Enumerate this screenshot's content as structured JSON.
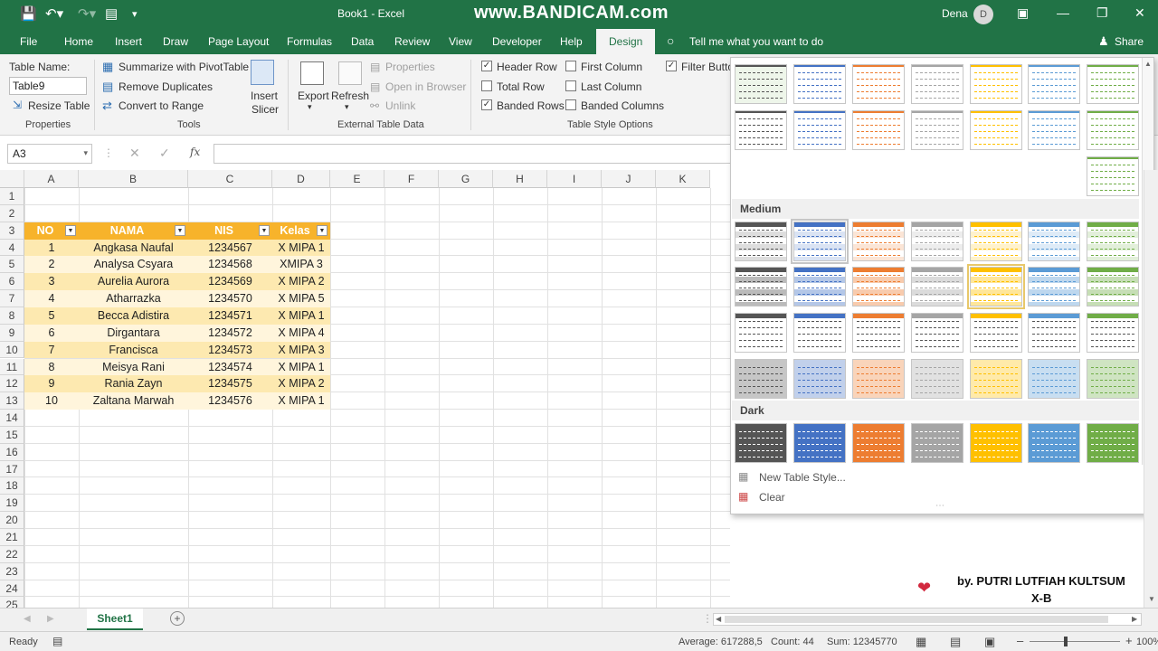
{
  "titlebar": {
    "title": "Book1  -  Excel",
    "watermark": "www.BANDICAM.com",
    "user_name": "Dena",
    "avatar_letter": "D",
    "accent_color": "#217346"
  },
  "tabs": [
    "File",
    "Home",
    "Insert",
    "Draw",
    "Page Layout",
    "Formulas",
    "Data",
    "Review",
    "View",
    "Developer",
    "Help",
    "Design"
  ],
  "active_tab": "Design",
  "tellme": "Tell me what you want to do",
  "share": "Share",
  "ribbon": {
    "properties": {
      "table_name_label": "Table Name:",
      "table_name_value": "Table9",
      "resize": "Resize Table",
      "group": "Properties"
    },
    "tools": {
      "pivot": "Summarize with PivotTable",
      "dupes": "Remove Duplicates",
      "convert": "Convert to Range",
      "slicer_l1": "Insert",
      "slicer_l2": "Slicer",
      "group": "Tools"
    },
    "external": {
      "export": "Export",
      "refresh": "Refresh",
      "properties": "Properties",
      "open_browser": "Open in Browser",
      "unlink": "Unlink",
      "group": "External Table Data"
    },
    "style_options": {
      "header_row": "Header Row",
      "total_row": "Total Row",
      "banded_rows": "Banded Rows",
      "first_column": "First Column",
      "last_column": "Last Column",
      "banded_columns": "Banded Columns",
      "filter_button": "Filter Butto",
      "group": "Table Style Options"
    }
  },
  "formula_bar": {
    "name_box": "A3",
    "value": ""
  },
  "columns": [
    "A",
    "B",
    "C",
    "D",
    "E",
    "F",
    "G",
    "H",
    "I",
    "J",
    "K"
  ],
  "rows": [
    "1",
    "2",
    "3",
    "4",
    "5",
    "6",
    "7",
    "8",
    "9",
    "10",
    "11",
    "12",
    "13",
    "14",
    "15",
    "16",
    "17",
    "18",
    "19",
    "20",
    "21",
    "22",
    "23",
    "24",
    "25"
  ],
  "table": {
    "headers": [
      "NO",
      "NAMA",
      "NIS",
      "Kelas"
    ],
    "rows": [
      [
        "1",
        "Angkasa Naufal",
        "1234567",
        "X MIPA 1"
      ],
      [
        "2",
        "Analysa Csyara",
        "1234568",
        "XMIPA 3"
      ],
      [
        "3",
        "Aurelia Aurora",
        "1234569",
        "X MIPA 2"
      ],
      [
        "4",
        "Atharrazka",
        "1234570",
        "X MIPA 5"
      ],
      [
        "5",
        "Becca Adistira",
        "1234571",
        "X MIPA 1"
      ],
      [
        "6",
        "Dirgantara",
        "1234572",
        "X MIPA 4"
      ],
      [
        "7",
        "Francisca",
        "1234573",
        "X MIPA 3"
      ],
      [
        "8",
        "Meisya Rani",
        "1234574",
        "X MIPA 1"
      ],
      [
        "9",
        "Rania Zayn",
        "1234575",
        "X MIPA 2"
      ],
      [
        "10",
        "Zaltana Marwah",
        "1234576",
        "X MIPA 1"
      ]
    ],
    "header_color": "#f7b32b",
    "band_color": "#fde9b0"
  },
  "gallery": {
    "section_medium": "Medium",
    "section_dark": "Dark",
    "new_style": "New Table Style...",
    "clear": "Clear",
    "palette": [
      "#555555",
      "#4472c4",
      "#ed7d31",
      "#a5a5a5",
      "#ffc000",
      "#5b9bd5",
      "#70ad47"
    ]
  },
  "sheet": {
    "tab": "Sheet1"
  },
  "status": {
    "ready": "Ready",
    "average": "Average: 617288,5",
    "count": "Count: 44",
    "sum": "Sum: 12345770",
    "zoom": "100%"
  },
  "credit": {
    "line1": "by. PUTRI LUTFIAH KULTSUM",
    "line2": "X-B"
  }
}
